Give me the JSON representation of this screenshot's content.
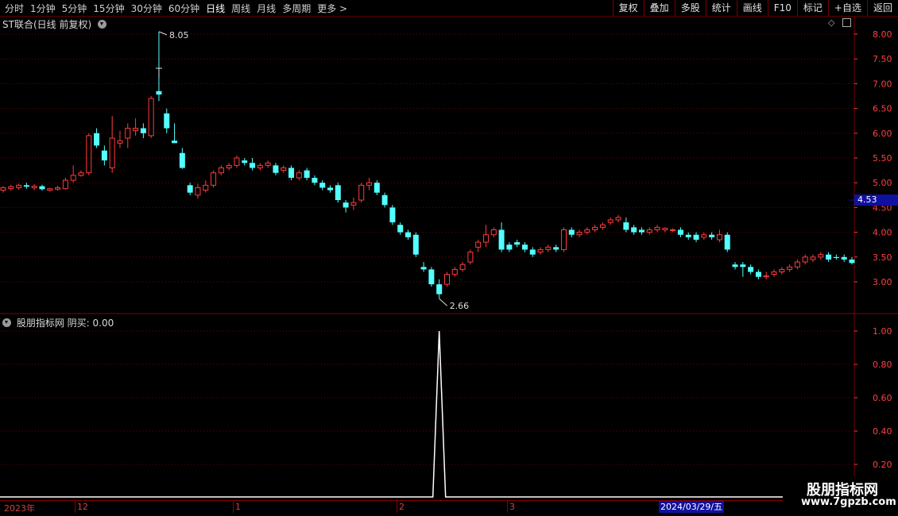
{
  "toolbar": {
    "periods": [
      "分时",
      "1分钟",
      "5分钟",
      "15分钟",
      "30分钟",
      "60分钟",
      "日线",
      "周线",
      "月线",
      "多周期",
      "更多 >"
    ],
    "active_period": "日线",
    "buttons": [
      "复权",
      "叠加",
      "多股",
      "统计",
      "画线",
      "F10",
      "标记",
      "+自选",
      "返回"
    ]
  },
  "main_panel": {
    "title": "ST联合(日线 前复权)",
    "max_label": "8.05",
    "min_label": "2.66",
    "current_price": "4.53",
    "y_ticks": [
      "8.00",
      "7.50",
      "7.00",
      "6.50",
      "6.00",
      "5.50",
      "5.00",
      "4.50",
      "4.00",
      "3.50",
      "3.00"
    ]
  },
  "indicator_panel": {
    "title": "股朋指标网 阴买: 0.00",
    "y_ticks": [
      "1.00",
      "0.80",
      "0.60",
      "0.40",
      "0.20"
    ]
  },
  "date_axis": {
    "labels": [
      "2023年",
      "12",
      "1",
      "2",
      "3"
    ],
    "highlight": "2024/03/29/五"
  },
  "watermark": {
    "title": "股朋指标网",
    "url": "www.7gpzb.com"
  },
  "colors": {
    "up": "#ff3c3c",
    "down": "#54ffff",
    "grid": "#7a0000",
    "axis_text": "#ff4040"
  },
  "chart_data": {
    "type": "candlestick",
    "title": "ST联合(日线 前复权)",
    "ylim": [
      2.5,
      8.2
    ],
    "candles": [
      [
        4.85,
        4.9,
        4.8,
        4.93
      ],
      [
        4.88,
        4.92,
        4.84,
        4.96
      ],
      [
        4.9,
        4.95,
        4.86,
        4.98
      ],
      [
        4.95,
        4.92,
        4.88,
        5.0
      ],
      [
        4.9,
        4.93,
        4.85,
        4.97
      ],
      [
        4.93,
        4.87,
        4.84,
        4.96
      ],
      [
        4.85,
        4.88,
        4.82,
        4.9
      ],
      [
        4.87,
        4.9,
        4.84,
        4.94
      ],
      [
        4.88,
        5.05,
        4.86,
        5.1
      ],
      [
        5.05,
        5.15,
        5.0,
        5.35
      ],
      [
        5.15,
        5.2,
        5.12,
        5.25
      ],
      [
        5.2,
        5.95,
        5.15,
        6.0
      ],
      [
        6.0,
        5.75,
        5.7,
        6.1
      ],
      [
        5.65,
        5.45,
        5.35,
        5.75
      ],
      [
        5.3,
        5.9,
        5.2,
        6.35
      ],
      [
        5.8,
        5.85,
        5.7,
        6.05
      ],
      [
        5.9,
        6.1,
        5.7,
        6.2
      ],
      [
        6.05,
        6.1,
        5.95,
        6.3
      ],
      [
        6.1,
        6.0,
        5.9,
        6.2
      ],
      [
        5.95,
        6.7,
        5.9,
        6.75
      ],
      [
        6.85,
        6.78,
        6.65,
        8.05
      ],
      [
        6.4,
        6.1,
        6.0,
        6.5
      ],
      [
        5.85,
        5.8,
        5.8,
        6.2
      ],
      [
        5.6,
        5.3,
        5.28,
        5.7
      ],
      [
        4.95,
        4.8,
        4.75,
        5.0
      ],
      [
        4.75,
        4.9,
        4.68,
        4.98
      ],
      [
        4.85,
        4.95,
        4.8,
        5.05
      ],
      [
        4.95,
        5.2,
        4.9,
        5.25
      ],
      [
        5.2,
        5.3,
        5.15,
        5.35
      ],
      [
        5.3,
        5.35,
        5.25,
        5.4
      ],
      [
        5.35,
        5.5,
        5.3,
        5.55
      ],
      [
        5.45,
        5.4,
        5.35,
        5.5
      ],
      [
        5.4,
        5.3,
        5.25,
        5.5
      ],
      [
        5.3,
        5.35,
        5.25,
        5.4
      ],
      [
        5.35,
        5.4,
        5.3,
        5.45
      ],
      [
        5.35,
        5.2,
        5.15,
        5.4
      ],
      [
        5.25,
        5.3,
        5.2,
        5.35
      ],
      [
        5.3,
        5.1,
        5.05,
        5.35
      ],
      [
        5.1,
        5.2,
        5.05,
        5.25
      ],
      [
        5.25,
        5.1,
        5.05,
        5.3
      ],
      [
        5.1,
        5.0,
        4.95,
        5.15
      ],
      [
        5.0,
        4.9,
        4.85,
        5.05
      ],
      [
        4.9,
        4.85,
        4.8,
        4.95
      ],
      [
        4.95,
        4.65,
        4.6,
        5.0
      ],
      [
        4.6,
        4.5,
        4.4,
        4.65
      ],
      [
        4.55,
        4.6,
        4.45,
        4.7
      ],
      [
        4.65,
        4.95,
        4.6,
        5.0
      ],
      [
        4.95,
        5.0,
        4.85,
        5.1
      ],
      [
        5.0,
        4.8,
        4.75,
        5.05
      ],
      [
        4.75,
        4.55,
        4.5,
        4.8
      ],
      [
        4.5,
        4.2,
        4.15,
        4.55
      ],
      [
        4.15,
        4.0,
        3.95,
        4.2
      ],
      [
        4.0,
        3.9,
        3.85,
        4.05
      ],
      [
        3.95,
        3.55,
        3.5,
        4.0
      ],
      [
        3.3,
        3.25,
        3.2,
        3.4
      ],
      [
        3.25,
        2.95,
        2.9,
        3.3
      ],
      [
        2.95,
        2.75,
        2.66,
        3.05
      ],
      [
        2.95,
        3.15,
        2.9,
        3.2
      ],
      [
        3.15,
        3.25,
        3.1,
        3.3
      ],
      [
        3.25,
        3.35,
        3.2,
        3.4
      ],
      [
        3.4,
        3.6,
        3.35,
        3.65
      ],
      [
        3.7,
        3.8,
        3.6,
        3.85
      ],
      [
        3.8,
        3.95,
        3.7,
        4.15
      ],
      [
        3.95,
        4.05,
        3.9,
        4.1
      ],
      [
        4.05,
        3.65,
        3.6,
        4.2
      ],
      [
        3.75,
        3.65,
        3.6,
        3.8
      ],
      [
        3.8,
        3.75,
        3.7,
        3.85
      ],
      [
        3.75,
        3.65,
        3.6,
        3.8
      ],
      [
        3.65,
        3.55,
        3.5,
        3.7
      ],
      [
        3.6,
        3.65,
        3.55,
        3.7
      ],
      [
        3.65,
        3.7,
        3.6,
        3.75
      ],
      [
        3.7,
        3.65,
        3.6,
        3.75
      ],
      [
        3.65,
        4.05,
        3.6,
        4.1
      ],
      [
        4.05,
        3.95,
        3.9,
        4.1
      ],
      [
        3.95,
        4.0,
        3.9,
        4.05
      ],
      [
        4.0,
        4.05,
        3.95,
        4.1
      ],
      [
        4.05,
        4.1,
        4.0,
        4.15
      ],
      [
        4.1,
        4.15,
        4.05,
        4.2
      ],
      [
        4.2,
        4.25,
        4.15,
        4.3
      ],
      [
        4.25,
        4.3,
        4.2,
        4.35
      ],
      [
        4.2,
        4.05,
        4.0,
        4.3
      ],
      [
        4.1,
        4.0,
        3.95,
        4.15
      ],
      [
        4.05,
        4.0,
        3.95,
        4.1
      ],
      [
        4.0,
        4.05,
        3.95,
        4.1
      ],
      [
        4.05,
        4.1,
        4.0,
        4.15
      ],
      [
        4.05,
        4.08,
        4.0,
        4.1
      ],
      [
        4.05,
        4.05,
        4.0,
        4.08
      ],
      [
        4.05,
        3.95,
        3.9,
        4.1
      ],
      [
        3.95,
        3.9,
        3.85,
        4.0
      ],
      [
        3.95,
        3.85,
        3.8,
        4.0
      ],
      [
        3.9,
        3.95,
        3.85,
        4.0
      ],
      [
        3.95,
        3.9,
        3.85,
        4.0
      ],
      [
        3.85,
        3.95,
        3.8,
        4.05
      ],
      [
        3.95,
        3.65,
        3.6,
        4.0
      ],
      [
        3.35,
        3.3,
        3.25,
        3.4
      ],
      [
        3.35,
        3.3,
        3.1,
        3.4
      ],
      [
        3.3,
        3.2,
        3.15,
        3.35
      ],
      [
        3.2,
        3.1,
        3.05,
        3.25
      ],
      [
        3.1,
        3.12,
        3.05,
        3.2
      ],
      [
        3.15,
        3.2,
        3.1,
        3.25
      ],
      [
        3.2,
        3.25,
        3.15,
        3.3
      ],
      [
        3.25,
        3.3,
        3.2,
        3.35
      ],
      [
        3.3,
        3.4,
        3.25,
        3.45
      ],
      [
        3.4,
        3.5,
        3.35,
        3.55
      ],
      [
        3.45,
        3.5,
        3.4,
        3.55
      ],
      [
        3.5,
        3.55,
        3.45,
        3.6
      ],
      [
        3.55,
        3.45,
        3.4,
        3.6
      ],
      [
        3.5,
        3.48,
        3.45,
        3.55
      ],
      [
        3.5,
        3.45,
        3.4,
        3.55
      ],
      [
        3.45,
        3.38,
        3.35,
        3.5
      ]
    ],
    "indicator": {
      "name": "阴买",
      "ylim": [
        0,
        1.05
      ],
      "values_nonzero_index": 56,
      "value": 1.0
    }
  }
}
